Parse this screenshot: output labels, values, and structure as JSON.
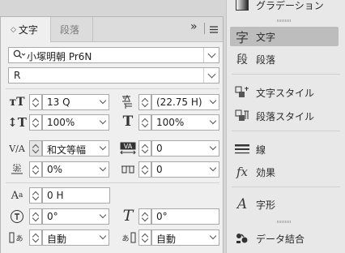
{
  "dock": {
    "items": [
      {
        "label": "グラデーション",
        "icon": "gradient-icon"
      },
      {
        "label": "文字",
        "icon": "character-icon",
        "glyph": "字"
      },
      {
        "label": "段落",
        "icon": "paragraph-icon",
        "glyph": "段"
      },
      {
        "label": "文字スタイル",
        "icon": "character-style-icon"
      },
      {
        "label": "段落スタイル",
        "icon": "paragraph-style-icon"
      },
      {
        "label": "線",
        "icon": "stroke-icon"
      },
      {
        "label": "効果",
        "icon": "effects-icon",
        "glyph": "fx"
      },
      {
        "label": "字形",
        "icon": "glyphs-icon",
        "glyph": "A"
      },
      {
        "label": "データ結合",
        "icon": "data-merge-icon"
      }
    ]
  },
  "panel": {
    "tabs": [
      {
        "label": "文字",
        "arrow": "◇"
      },
      {
        "label": "段落"
      }
    ],
    "collapse": "»",
    "font_family": "小塚明朝 Pr6N",
    "font_style": "R",
    "font_size": "13 Q",
    "leading": "(22.75 H)",
    "vertical_scale": "100%",
    "horizontal_scale": "100%",
    "kerning": "和文等幅",
    "tracking": "0",
    "tsume": "0%",
    "aki": "0",
    "baseline_shift": "0 H",
    "character_rotation": "0°",
    "skew": "0°",
    "aki_before": "自動",
    "aki_after": "自動"
  },
  "colors": {
    "active_dock_item": "#bdbdbd",
    "panel_bg": "#efefef"
  }
}
